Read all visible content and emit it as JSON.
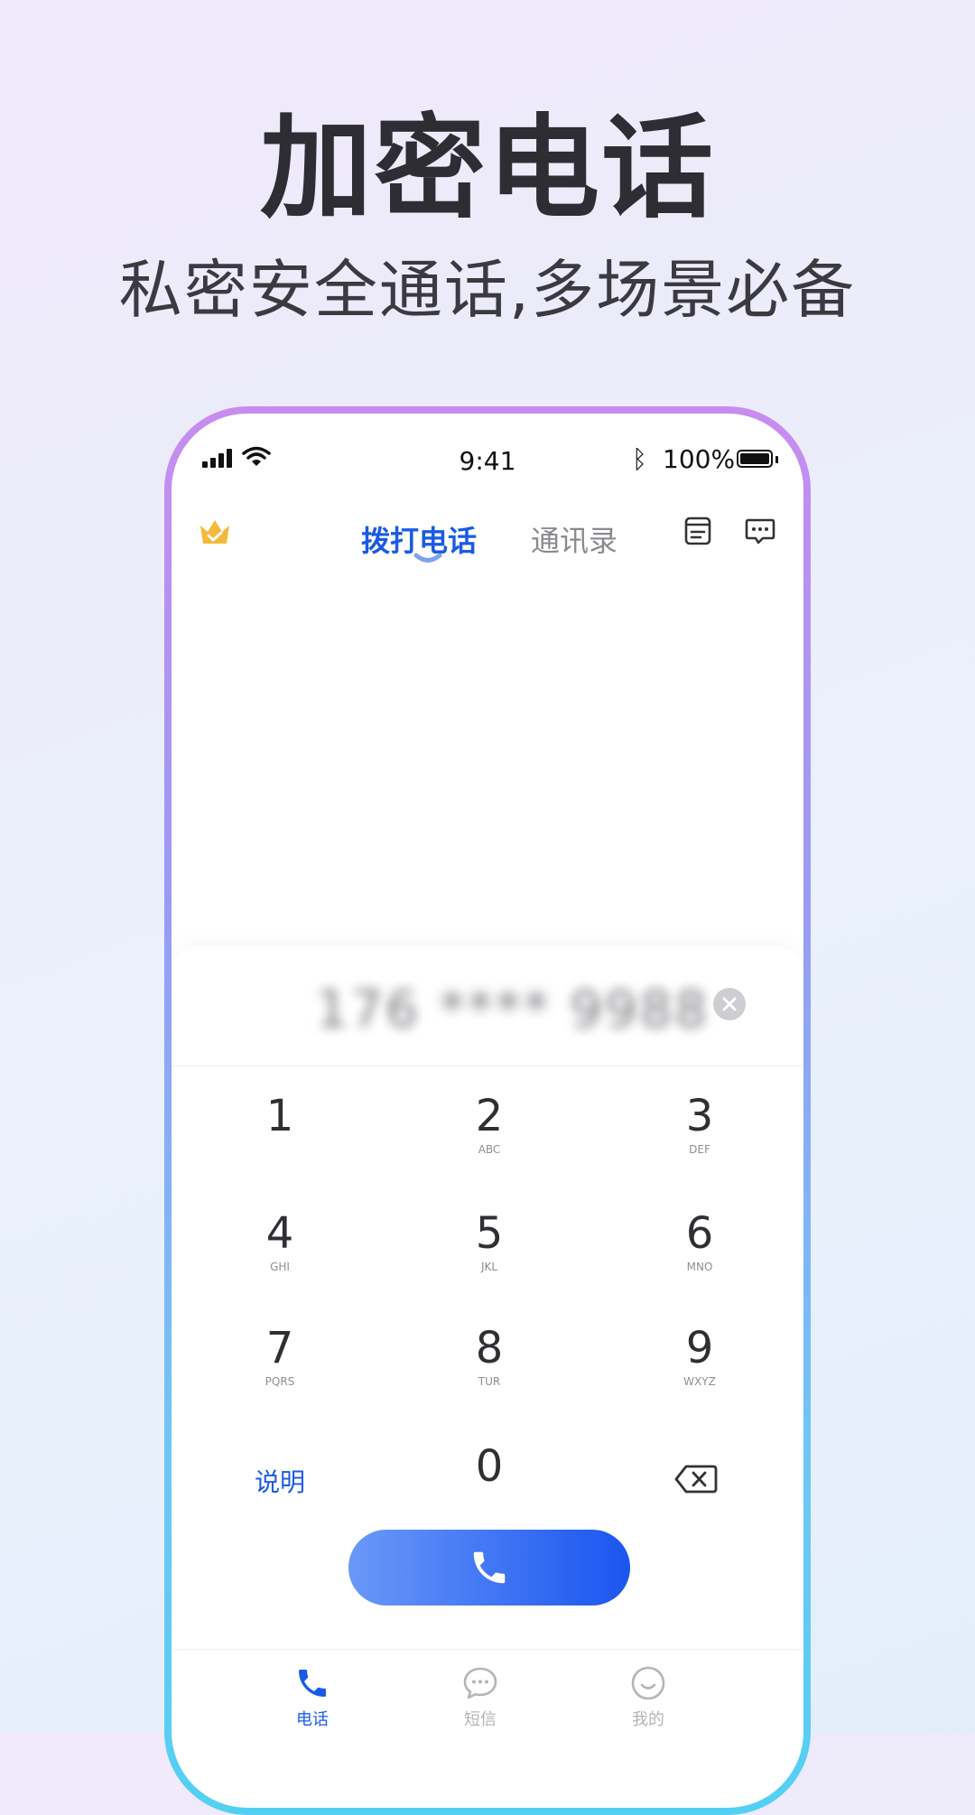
{
  "headline": "加密电话",
  "subheadline": "私密安全通话,多场景必备",
  "status_bar": {
    "time": "9:41",
    "battery": "100%"
  },
  "top_nav": {
    "tabs": [
      {
        "label": "拨打电话",
        "active": true
      },
      {
        "label": "通讯录",
        "active": false
      }
    ]
  },
  "dialer": {
    "number": "176 **** 9988",
    "keys": [
      {
        "digit": "1",
        "letters": ""
      },
      {
        "digit": "2",
        "letters": "ABC"
      },
      {
        "digit": "3",
        "letters": "DEF"
      },
      {
        "digit": "4",
        "letters": "GHI"
      },
      {
        "digit": "5",
        "letters": "JKL"
      },
      {
        "digit": "6",
        "letters": "MNO"
      },
      {
        "digit": "7",
        "letters": "PQRS"
      },
      {
        "digit": "8",
        "letters": "TUR"
      },
      {
        "digit": "9",
        "letters": "WXYZ"
      },
      {
        "digit": "0",
        "letters": ""
      }
    ],
    "explain_label": "说明"
  },
  "bottom_tabs": [
    {
      "label": "电话",
      "icon": "phone-icon",
      "active": true
    },
    {
      "label": "短信",
      "icon": "message-icon",
      "active": false
    },
    {
      "label": "我的",
      "icon": "smile-icon",
      "active": false
    }
  ],
  "colors": {
    "accent": "#1b5ae6",
    "inactive": "#b4b4b8",
    "crown": "#f5b93a"
  }
}
